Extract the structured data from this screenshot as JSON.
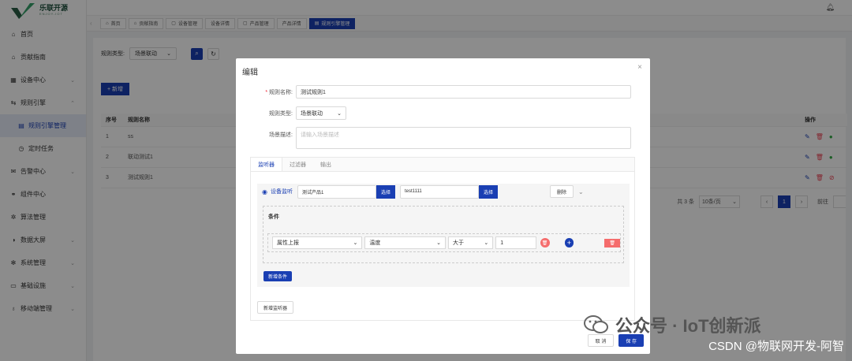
{
  "brand": {
    "name": "乐联开源",
    "sub": "ENJOY-IOT"
  },
  "menu": [
    {
      "label": "首页",
      "icon": "home-icon",
      "glyph": "⌂"
    },
    {
      "label": "贡献指南",
      "icon": "home-icon",
      "glyph": "⌂"
    },
    {
      "label": "设备中心",
      "icon": "grid-icon",
      "glyph": "▦",
      "chev": "⌄"
    },
    {
      "label": "规则引擎",
      "icon": "rules-icon",
      "glyph": "⇆",
      "chev": "⌃"
    },
    {
      "label": "规则引擎管理",
      "icon": "table-icon",
      "glyph": "▤",
      "sub": true,
      "active": true
    },
    {
      "label": "定时任务",
      "icon": "clock-icon",
      "glyph": "◷",
      "sub": true
    },
    {
      "label": "告警中心",
      "icon": "mail-icon",
      "glyph": "✉",
      "chev": "⌄"
    },
    {
      "label": "组件中心",
      "icon": "link-icon",
      "glyph": "⚭"
    },
    {
      "label": "算法管理",
      "icon": "gear-icon",
      "glyph": "✲"
    },
    {
      "label": "数据大屏",
      "icon": "dashboard-icon",
      "glyph": "◑",
      "chev": "⌄"
    },
    {
      "label": "系统管理",
      "icon": "settings-icon",
      "glyph": "✻",
      "chev": "⌄"
    },
    {
      "label": "基础设施",
      "icon": "monitor-icon",
      "glyph": "▭",
      "chev": "⌄"
    },
    {
      "label": "移动端管理",
      "icon": "bulb-icon",
      "glyph": "♁",
      "chev": "⌄"
    }
  ],
  "tabs": [
    "首页",
    "贡献指南",
    "设备管理",
    "设备详情",
    "产品管理",
    "产品详情",
    "规则引擎管理"
  ],
  "filter": {
    "label": "规则类型:",
    "value": "场景联动"
  },
  "add_label": "+ 新增",
  "table": {
    "headers": [
      "序号",
      "规则名称",
      "操作"
    ],
    "rows": [
      {
        "idx": "1",
        "name": "ss"
      },
      {
        "idx": "2",
        "name": "联动测试1"
      },
      {
        "idx": "3",
        "name": "测试规则1"
      }
    ]
  },
  "pager": {
    "total": "共 3 条",
    "size": "10条/页",
    "page": "1",
    "goto": "前往"
  },
  "dialog": {
    "title": "编辑",
    "close": "×",
    "name_label": "规则名称:",
    "name_value": "测试规则1",
    "type_label": "规则类型:",
    "type_value": "场景联动",
    "desc_label": "场景描述:",
    "desc_placeholder": "请输入场景描述",
    "panel_tabs": [
      "监听器",
      "过滤器",
      "输出"
    ],
    "listener": {
      "label": "设备监听",
      "product": "测试产品1",
      "select1": "选择",
      "device": "test1111",
      "select2": "选择",
      "delete": "删除"
    },
    "condition": {
      "title": "条件",
      "type": "属性上报",
      "prop": "温度",
      "op": "大于",
      "value": "1"
    },
    "add_condition": "新增条件",
    "add_listener": "新增监听器",
    "cancel": "取 消",
    "save": "保 存"
  },
  "watermark": {
    "main": "公众号 · IoT创新派",
    "sub": "CSDN @物联网开发-阿智"
  }
}
